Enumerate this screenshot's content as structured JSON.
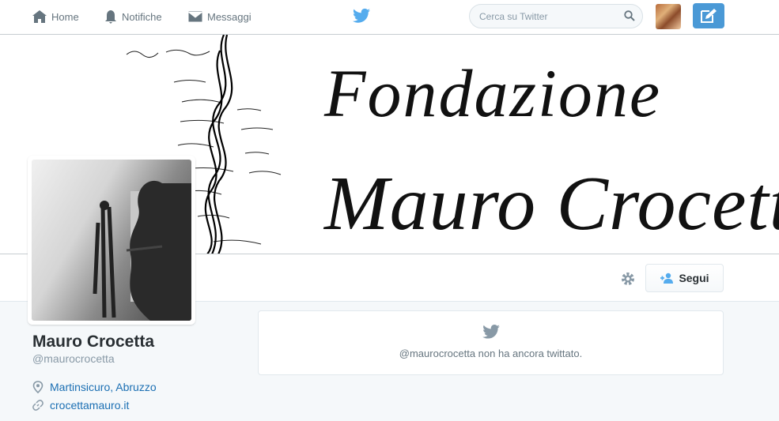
{
  "nav": {
    "home_label": "Home",
    "notifications_label": "Notifiche",
    "messages_label": "Messaggi"
  },
  "search": {
    "placeholder": "Cerca su Twitter"
  },
  "banner": {
    "line1": "Fondazione",
    "line2": "Mauro Crocetta"
  },
  "profile": {
    "name": "Mauro Crocetta",
    "handle": "@maurocrocetta",
    "location": "Martinsicuro, Abruzzo",
    "website": "crocettamauro.it"
  },
  "actions": {
    "follow_label": "Segui"
  },
  "timeline": {
    "empty_message": "@maurocrocetta non ha ancora twittato."
  },
  "colors": {
    "accent": "#1da1f2",
    "link": "#1b6fb3",
    "tweet_button": "#4a99d6"
  }
}
